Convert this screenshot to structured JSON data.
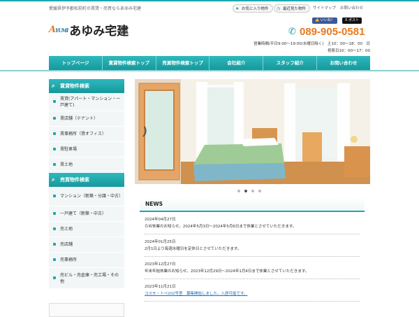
{
  "header": {
    "tagline": "愛媛県伊予郡松前町の賃貸・売買ならあゆみ宅建",
    "favorites": "お気に入り物件",
    "recent": "最近見た物件",
    "sitemap": "サイトマップ",
    "contact_link": "お問い合わせ",
    "logo_mark": "YUMI",
    "logo_name": "あゆみ宅建",
    "like": "いいね！",
    "post": "ポスト",
    "phone": "089-905-0581",
    "hours1": "営業時間/平日9:00～19:00(水曜日除く)　土10：00～18：00　日",
    "hours2": "祝祭日10：00～17：00"
  },
  "nav": [
    "トップページ",
    "賃貸物件検索トップ",
    "売買物件検索トップ",
    "会社紹介",
    "スタッフ紹介",
    "お問い合わせ"
  ],
  "sidebar": {
    "rent_title": "賃貸物件検索",
    "rent_items": [
      "賃貸(アパート・マンション・一戸建て)",
      "賃店舗（テナント）",
      "賃事務所（貸オフィス）",
      "賃駐車場",
      "賃土地"
    ],
    "sale_title": "売買物件検索",
    "sale_items": [
      "マンション（新築・分譲・中古）",
      "一戸建て（新築・中古）",
      "売土地",
      "売店舗",
      "売事務所",
      "売ビル・売倉庫・売工場・その他"
    ]
  },
  "news": {
    "title": "NEWS",
    "entries": [
      {
        "date": "2024年04月27日",
        "text": "ＧＷ休業のお知らせ。2024年5月3日～2024年5月6日まで休業とさせていただきます。"
      },
      {
        "date": "2024年01月25日",
        "text": "2月1日より毎週水曜日を定休日とさせていただきます。"
      },
      {
        "date": "2023年12月27日",
        "text": "年末年始休業のお知らせ。2023年12月29日～2024年1月4日まで休業とさせていただきます。"
      },
      {
        "date": "2023年11月21日",
        "text": "コスモ・トベ202号室　募集開始しました。入居可能です。"
      }
    ]
  },
  "colors": {
    "accent": "#19a9ad",
    "phone": "#e8791c"
  }
}
